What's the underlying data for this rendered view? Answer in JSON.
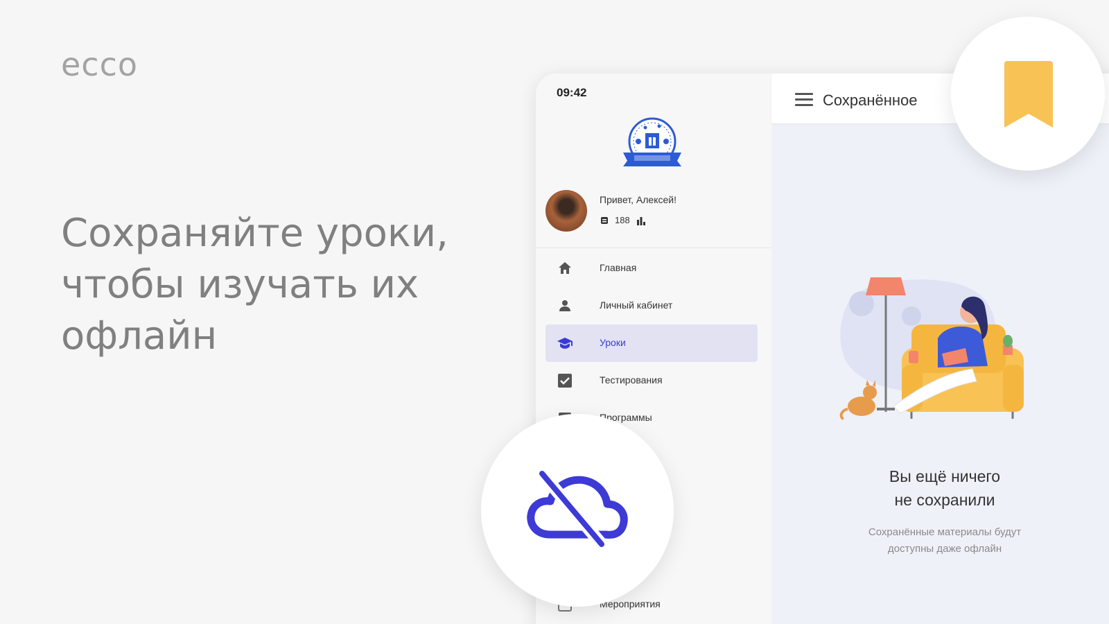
{
  "brand": {
    "logo_text": "ecco"
  },
  "promo": {
    "line1": "Сохраняйте уроки,",
    "line2": "чтобы изучать их",
    "line3": "офлайн"
  },
  "phone": {
    "status_time": "09:42",
    "profile": {
      "greeting": "Привет, Алексей!",
      "points": "188"
    },
    "menu": [
      {
        "label": "Главная",
        "icon": "home-icon",
        "active": false
      },
      {
        "label": "Личный кабинет",
        "icon": "person-icon",
        "active": false
      },
      {
        "label": "Уроки",
        "icon": "graduation-cap-icon",
        "active": true
      },
      {
        "label": "Тестирования",
        "icon": "checkbox-icon",
        "active": false
      },
      {
        "label": "Программы",
        "icon": "program-icon",
        "active": false
      },
      {
        "label": "Мероприятия",
        "icon": "calendar-icon",
        "active": false
      }
    ],
    "appbar": {
      "title": "Сохранённое"
    },
    "empty_state": {
      "title_line1": "Вы ещё ничего",
      "title_line2": "не сохранили",
      "sub_line1": "Сохранённые материалы будут",
      "sub_line2": "доступны даже офлайн"
    }
  },
  "colors": {
    "accent": "#3a3ad6",
    "bookmark": "#f8c254",
    "active_item_bg": "#e2e2f3"
  }
}
